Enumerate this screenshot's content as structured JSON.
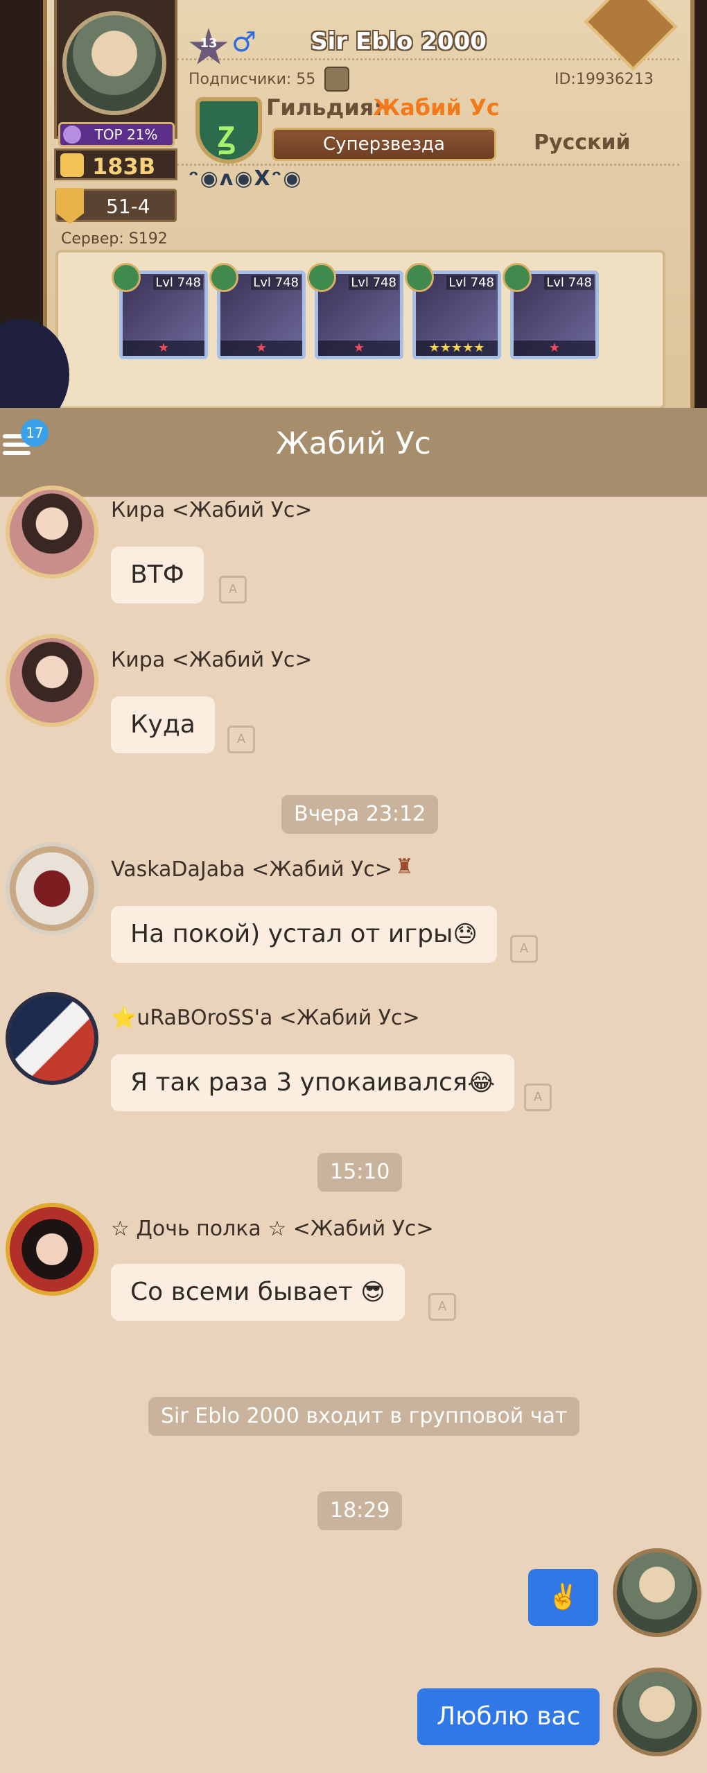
{
  "profile": {
    "level": "13",
    "gender_icon": "♂",
    "name": "Sir Eblo 2000",
    "top_label": "TOP 21%",
    "power": "183B",
    "stage": "51-4",
    "server": "Сервер: S192",
    "subscribers": "Подписчики: 55",
    "id": "ID:19936213",
    "guild_prefix": "Гильдия:",
    "guild_name": "Жабий Ус",
    "guild_rank": "Суперзвезда",
    "language": "Русский",
    "badges": "ᵔ◉ᴧ◉Xᵔ◉",
    "heroes": [
      {
        "level": "Lvl 748",
        "stars": "★",
        "gold": false
      },
      {
        "level": "Lvl 748",
        "stars": "★",
        "gold": false
      },
      {
        "level": "Lvl 748",
        "stars": "★",
        "gold": false
      },
      {
        "level": "Lvl 748",
        "stars": "★★★★★",
        "gold": true
      },
      {
        "level": "Lvl 748",
        "stars": "★",
        "gold": false
      }
    ]
  },
  "chat": {
    "title": "Жабий Ус",
    "unread_badge": "17",
    "translate_icon_label": "A",
    "messages": [
      {
        "sender": "Кира <Жабий Ус>",
        "text": "ВТФ"
      },
      {
        "sender": "Кира <Жабий Ус>",
        "text": "Куда"
      },
      {
        "sender": "VaskaDaJaba <Жабий Ус>",
        "text": "На покой) устал от игры",
        "emoji": "😓"
      },
      {
        "sender": "⭐uRaBOroSS'a <Жабий Ус>",
        "text": "Я так раза 3 упокаивался",
        "emoji": "😂"
      },
      {
        "sender": "☆ Дочь полка ☆ <Жабий Ус>",
        "text": "Со всеми бывает",
        "emoji": "😎"
      }
    ],
    "time_yesterday": "Вчера 23:12",
    "time_1510": "15:10",
    "system_join": "Sir Eblo 2000 входит в групповой чат",
    "time_1829": "18:29",
    "my_messages": [
      {
        "text": "✌️"
      },
      {
        "text": "Люблю вас"
      }
    ]
  }
}
